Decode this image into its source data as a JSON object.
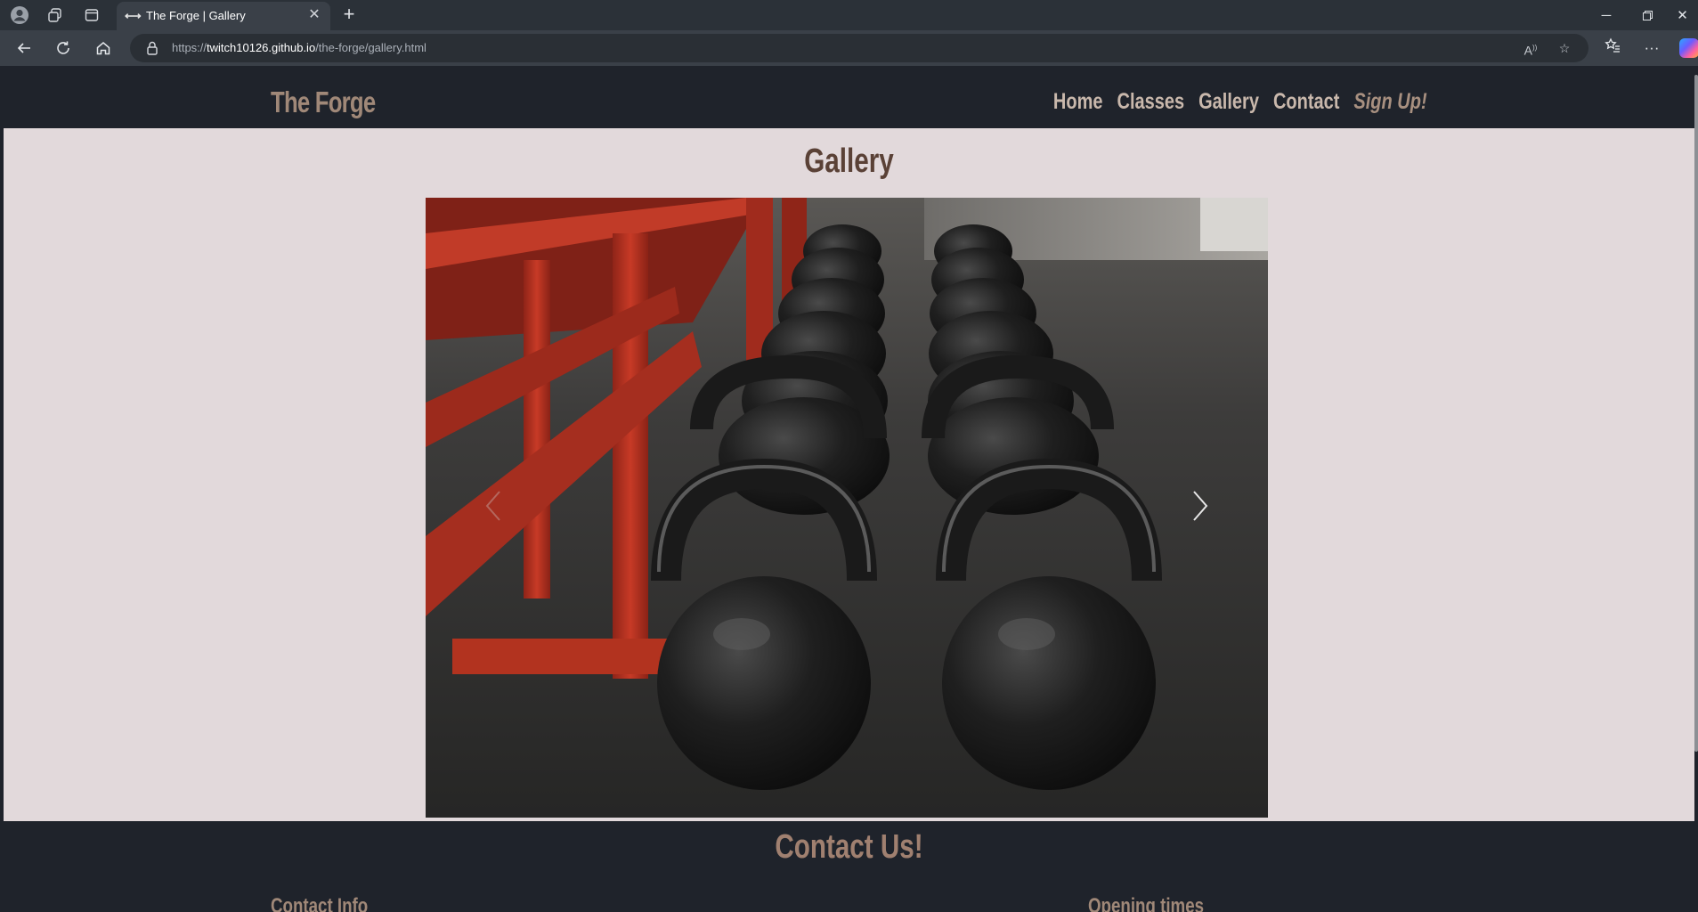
{
  "browser": {
    "tab_title": "The Forge | Gallery",
    "url_prefix": "https://",
    "url_host": "twitch10126.github.io",
    "url_path": "/the-forge/gallery.html"
  },
  "site": {
    "logo": "The Forge",
    "nav": [
      "Home",
      "Classes",
      "Gallery",
      "Contact",
      "Sign Up!"
    ]
  },
  "main": {
    "title": "Gallery"
  },
  "footer": {
    "title": "Contact Us!",
    "contact_info": "Contact Info",
    "opening_times": "Opening times"
  },
  "colors": {
    "page_bg": "#e2d9db",
    "header_bg": "#1f232b",
    "brand": "#a08878",
    "title": "#5a4136"
  }
}
